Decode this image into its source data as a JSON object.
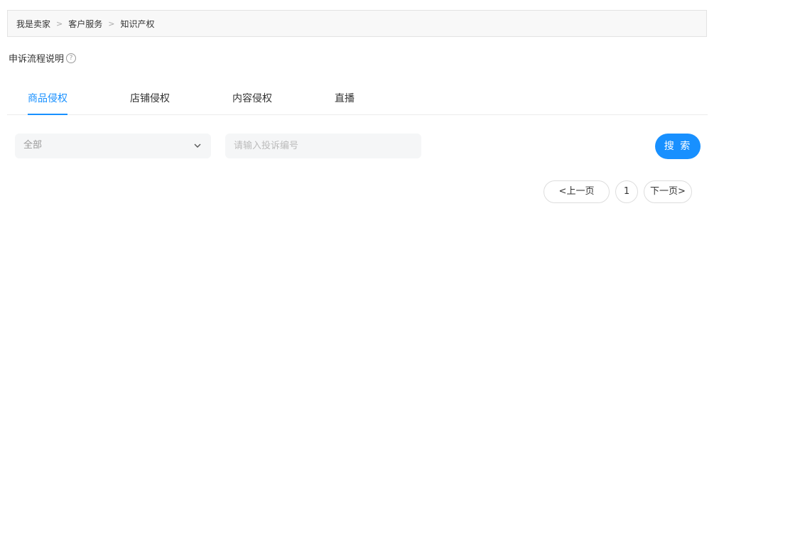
{
  "breadcrumb": {
    "items": [
      "我是卖家",
      "客户服务",
      "知识产权"
    ],
    "separator": ">"
  },
  "process_link": {
    "label": "申诉流程说明",
    "help_icon": "?"
  },
  "tabs": [
    {
      "label": "商品侵权",
      "active": true
    },
    {
      "label": "店铺侵权",
      "active": false
    },
    {
      "label": "内容侵权",
      "active": false
    },
    {
      "label": "直播",
      "active": false
    }
  ],
  "filter": {
    "select_value": "全部",
    "search_placeholder": "请输入投诉编号",
    "search_button_label": "搜 索"
  },
  "pagination": {
    "prev_label": "<上一页",
    "current_page": "1",
    "next_label": "下一页>"
  },
  "colors": {
    "accent": "#1890ff",
    "field_bg": "#f5f6f7",
    "breadcrumb_bg": "#f8f8f8"
  }
}
